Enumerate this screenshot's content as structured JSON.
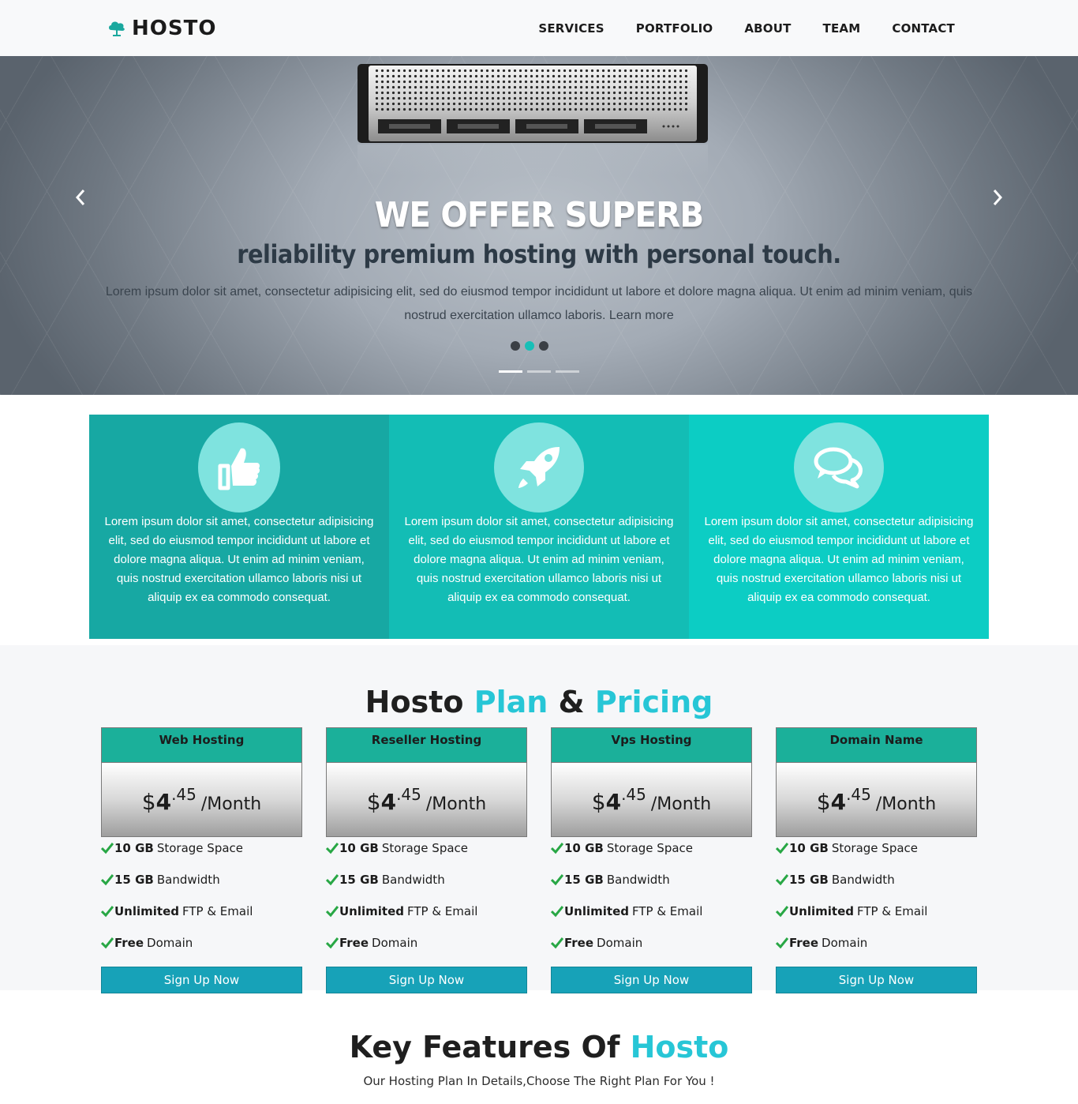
{
  "brand": {
    "name": "HOSTO"
  },
  "nav": {
    "items": [
      "SERVICES",
      "PORTFOLIO",
      "ABOUT",
      "TEAM",
      "CONTACT"
    ]
  },
  "hero": {
    "title": "WE OFFER SUPERB",
    "subtitle": "reliability premium hosting with personal touch.",
    "body": "Lorem ipsum dolor sit amet, consectetur adipisicing elit, sed do eiusmod tempor incididunt ut labore et dolore magna aliqua. Ut enim ad minim veniam, quis nostrud exercitation ullamco laboris. Learn more",
    "prev_icon": "chevron-left-icon",
    "next_icon": "chevron-right-icon",
    "active_slide": 2,
    "slide_count": 3,
    "active_indicator": 1
  },
  "features": {
    "items": [
      {
        "icon": "thumbs-up-icon",
        "color": "#17a8a3",
        "text": "Lorem ipsum dolor sit amet, consectetur adipisicing elit, sed do eiusmod tempor incididunt ut labore et dolore magna aliqua. Ut enim ad minim veniam, quis nostrud exercitation ullamco laboris nisi ut aliquip ex ea commodo consequat."
      },
      {
        "icon": "rocket-icon",
        "color": "#13bdb5",
        "text": "Lorem ipsum dolor sit amet, consectetur adipisicing elit, sed do eiusmod tempor incididunt ut labore et dolore magna aliqua. Ut enim ad minim veniam, quis nostrud exercitation ullamco laboris nisi ut aliquip ex ea commodo consequat."
      },
      {
        "icon": "chat-bubbles-icon",
        "color": "#0ccdc4",
        "text": "Lorem ipsum dolor sit amet, consectetur adipisicing elit, sed do eiusmod tempor incididunt ut labore et dolore magna aliqua. Ut enim ad minim veniam, quis nostrud exercitation ullamco laboris nisi ut aliquip ex ea commodo consequat."
      }
    ]
  },
  "pricing": {
    "heading": {
      "part1": "Hosto",
      "part2": "Plan",
      "part3": "&",
      "part4": "Pricing"
    },
    "accent_color": "#27c6d6",
    "plans": [
      {
        "name": "Web Hosting",
        "currency": "$",
        "price_int": "4",
        "price_dec": ".45",
        "period": "/Month",
        "features": [
          {
            "bold": "10 GB",
            "text": "Storage Space"
          },
          {
            "bold": "15 GB",
            "text": "Bandwidth"
          },
          {
            "bold": "Unlimited",
            "text": "FTP & Email"
          },
          {
            "bold": "Free",
            "text": "Domain"
          }
        ],
        "cta": "Sign Up Now"
      },
      {
        "name": "Reseller Hosting",
        "currency": "$",
        "price_int": "4",
        "price_dec": ".45",
        "period": "/Month",
        "features": [
          {
            "bold": "10 GB",
            "text": "Storage Space"
          },
          {
            "bold": "15 GB",
            "text": "Bandwidth"
          },
          {
            "bold": "Unlimited",
            "text": "FTP & Email"
          },
          {
            "bold": "Free",
            "text": "Domain"
          }
        ],
        "cta": "Sign Up Now"
      },
      {
        "name": "Vps Hosting",
        "currency": "$",
        "price_int": "4",
        "price_dec": ".45",
        "period": "/Month",
        "features": [
          {
            "bold": "10 GB",
            "text": "Storage Space"
          },
          {
            "bold": "15 GB",
            "text": "Bandwidth"
          },
          {
            "bold": "Unlimited",
            "text": "FTP & Email"
          },
          {
            "bold": "Free",
            "text": "Domain"
          }
        ],
        "cta": "Sign Up Now"
      },
      {
        "name": "Domain Name",
        "currency": "$",
        "price_int": "4",
        "price_dec": ".45",
        "period": "/Month",
        "features": [
          {
            "bold": "10 GB",
            "text": "Storage Space"
          },
          {
            "bold": "15 GB",
            "text": "Bandwidth"
          },
          {
            "bold": "Unlimited",
            "text": "FTP & Email"
          },
          {
            "bold": "Free",
            "text": "Domain"
          }
        ],
        "cta": "Sign Up Now"
      }
    ]
  },
  "key_features": {
    "heading_main": "Key Features Of",
    "heading_accent": "Hosto",
    "subheading": "Our Hosting Plan In Details,Choose The Right Plan For You !"
  }
}
